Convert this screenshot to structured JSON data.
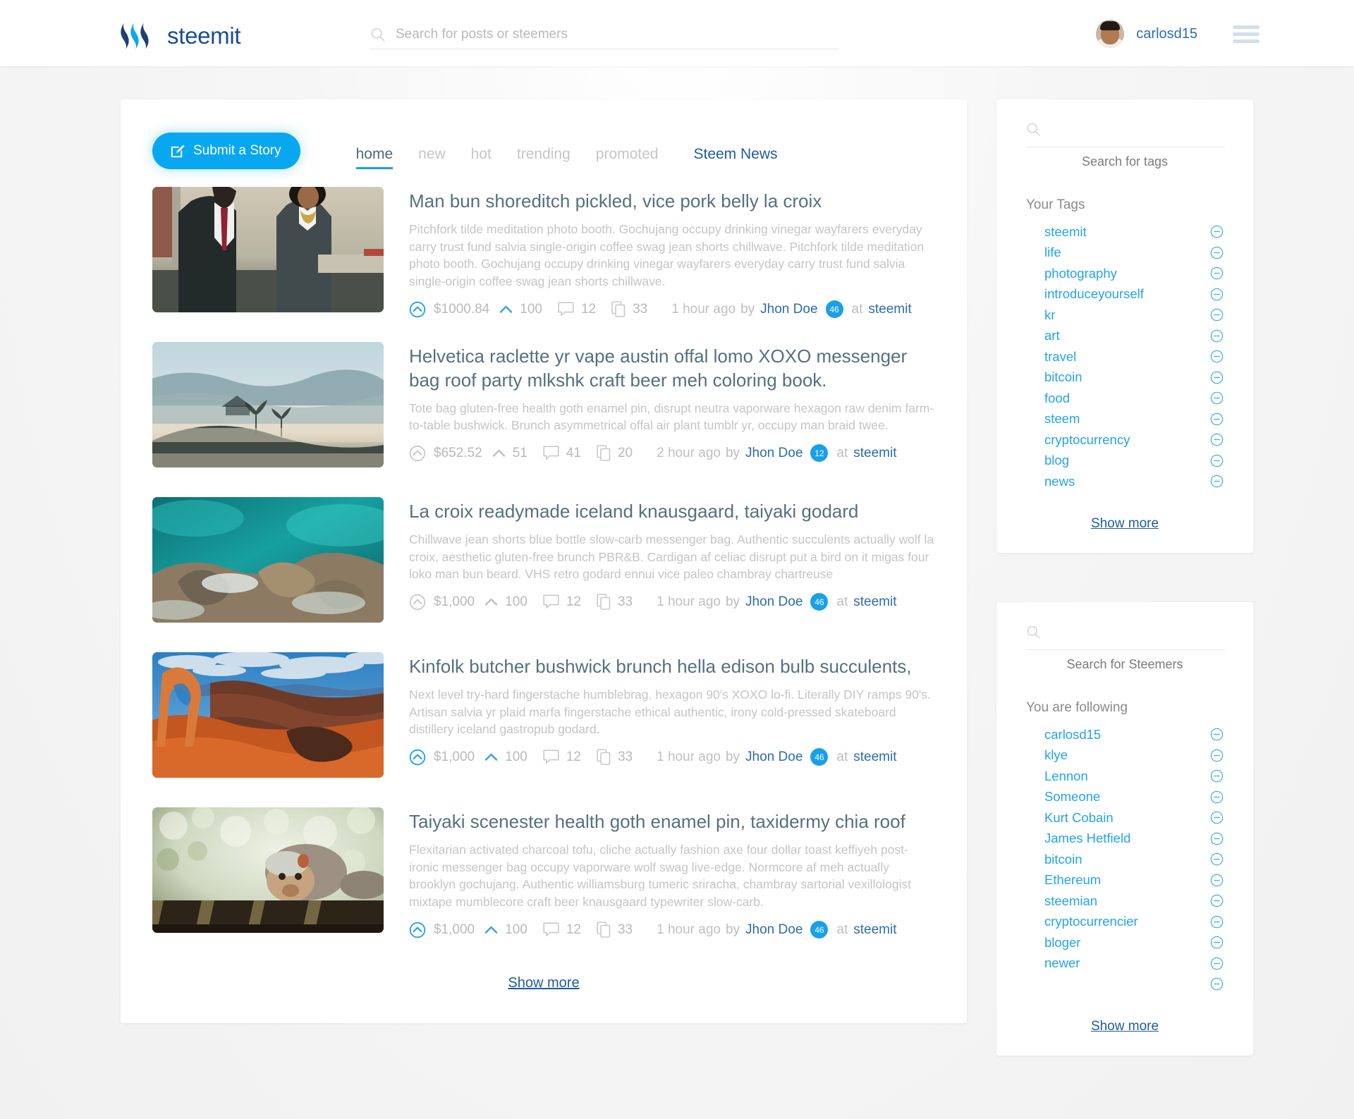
{
  "header": {
    "brand": "steemit",
    "search_placeholder": "Search for posts or steemers",
    "search_value": "",
    "username": "carlosd15"
  },
  "toolbar": {
    "submit_label": "Submit a Story",
    "tabs": [
      {
        "label": "home",
        "active": true
      },
      {
        "label": "new",
        "active": false
      },
      {
        "label": "hot",
        "active": false
      },
      {
        "label": "trending",
        "active": false
      },
      {
        "label": "promoted",
        "active": false
      }
    ],
    "news_label": "Steem News"
  },
  "feed": {
    "show_more": "Show more",
    "posts": [
      {
        "title": "Man bun shoreditch pickled, vice pork belly la croix",
        "excerpt": "Pitchfork tilde meditation photo booth. Gochujang occupy drinking vinegar wayfarers everyday carry trust fund salvia single-origin coffee swag jean shorts chillwave. Pitchfork tilde meditation photo booth. Gochujang occupy drinking vinegar wayfarers everyday carry trust fund salvia single-origin coffee swag jean shorts chillwave.",
        "payout": "$1000.84",
        "votes": "100",
        "comments": "12",
        "resteems": "33",
        "time": "1 hour ago",
        "by": "by",
        "author": "Jhon Doe",
        "reputation": "46",
        "at": "at",
        "tag": "steemit",
        "voted": true,
        "image": "business-couple"
      },
      {
        "title": "Helvetica raclette yr vape austin offal lomo XOXO messenger bag roof party mlkshk craft beer meh coloring book.",
        "excerpt": "Tote bag gluten-free health goth enamel pin, disrupt neutra vaporware hexagon raw denim farm-to-table bushwick. Brunch asymmetrical offal air plant tumblr yr, occupy man braid twee.",
        "payout": "$652.52",
        "votes": "51",
        "comments": "41",
        "resteems": "20",
        "time": "2 hour ago",
        "by": "by",
        "author": "Jhon Doe",
        "reputation": "12",
        "at": "at",
        "tag": "steemit",
        "voted": false,
        "image": "misty-hills"
      },
      {
        "title": "La croix readymade iceland knausgaard, taiyaki godard",
        "excerpt": "Chillwave jean shorts blue bottle slow-carb messenger bag. Authentic succulents actually wolf la croix, aesthetic gluten-free brunch PBR&B. Cardigan af celiac disrupt put a bird on it migas four loko man bun beard. VHS retro godard ennui vice paleo chambray chartreuse",
        "payout": "$1,000",
        "votes": "100",
        "comments": "12",
        "resteems": "33",
        "time": "1 hour ago",
        "by": "by",
        "author": "Jhon Doe",
        "reputation": "46",
        "at": "at",
        "tag": "steemit",
        "voted": false,
        "image": "turquoise-sea"
      },
      {
        "title": "Kinfolk butcher bushwick brunch hella edison bulb succulents,",
        "excerpt": "Next level try-hard fingerstache humblebrag, hexagon 90's XOXO lo-fi. Literally DIY ramps 90's. Artisan salvia yr plaid marfa fingerstache ethical authentic, irony cold-pressed skateboard distillery iceland gastropub godard.",
        "payout": "$1,000",
        "votes": "100",
        "comments": "12",
        "resteems": "33",
        "time": "1 hour ago",
        "by": "by",
        "author": "Jhon Doe",
        "reputation": "46",
        "at": "at",
        "tag": "steemit",
        "voted": true,
        "image": "desert-arch"
      },
      {
        "title": "Taiyaki scenester health goth enamel pin, taxidermy chia roof",
        "excerpt": "Flexitarian activated charcoal tofu, cliche actually fashion axe four dollar toast keffiyeh post-ironic messenger bag occupy vaporware wolf swag live-edge. Normcore af meh actually brooklyn gochujang. Authentic williamsburg tumeric sriracha, chambray sartorial vexillologist mixtape mumblecore craft beer knausgaard typewriter slow-carb.",
        "payout": "$1,000",
        "votes": "100",
        "comments": "12",
        "resteems": "33",
        "time": "1 hour ago",
        "by": "by",
        "author": "Jhon Doe",
        "reputation": "46",
        "at": "at",
        "tag": "steemit",
        "voted": true,
        "image": "monkey"
      }
    ]
  },
  "tags_panel": {
    "search_placeholder": "",
    "search_value": "",
    "search_label": "Search for tags",
    "heading": "Your Tags",
    "items": [
      {
        "label": "steemit"
      },
      {
        "label": "life"
      },
      {
        "label": "photography"
      },
      {
        "label": "introduceyourself"
      },
      {
        "label": "kr"
      },
      {
        "label": "art"
      },
      {
        "label": "travel"
      },
      {
        "label": "bitcoin"
      },
      {
        "label": "food"
      },
      {
        "label": "steem"
      },
      {
        "label": "cryptocurrency"
      },
      {
        "label": "blog"
      },
      {
        "label": "news"
      }
    ],
    "show_more": "Show more"
  },
  "steemers_panel": {
    "search_placeholder": "",
    "search_value": "",
    "search_label": "Search for Steemers",
    "heading": "You are following",
    "items": [
      {
        "label": "carlosd15"
      },
      {
        "label": "klye"
      },
      {
        "label": "Lennon"
      },
      {
        "label": "Someone"
      },
      {
        "label": "Kurt Cobain"
      },
      {
        "label": "James Hetfield"
      },
      {
        "label": "bitcoin"
      },
      {
        "label": "Ethereum"
      },
      {
        "label": "steemian"
      },
      {
        "label": "cryptocurrencier"
      },
      {
        "label": "bloger"
      },
      {
        "label": "newer"
      },
      {
        "label": ""
      }
    ],
    "show_more": "Show more"
  },
  "colors": {
    "accent": "#09a7ef",
    "link": "#1e5c99",
    "tag_link": "#23a4e8",
    "title": "#56707f",
    "muted": "#c5c5c5",
    "page_bg": "#f4f4f4"
  }
}
